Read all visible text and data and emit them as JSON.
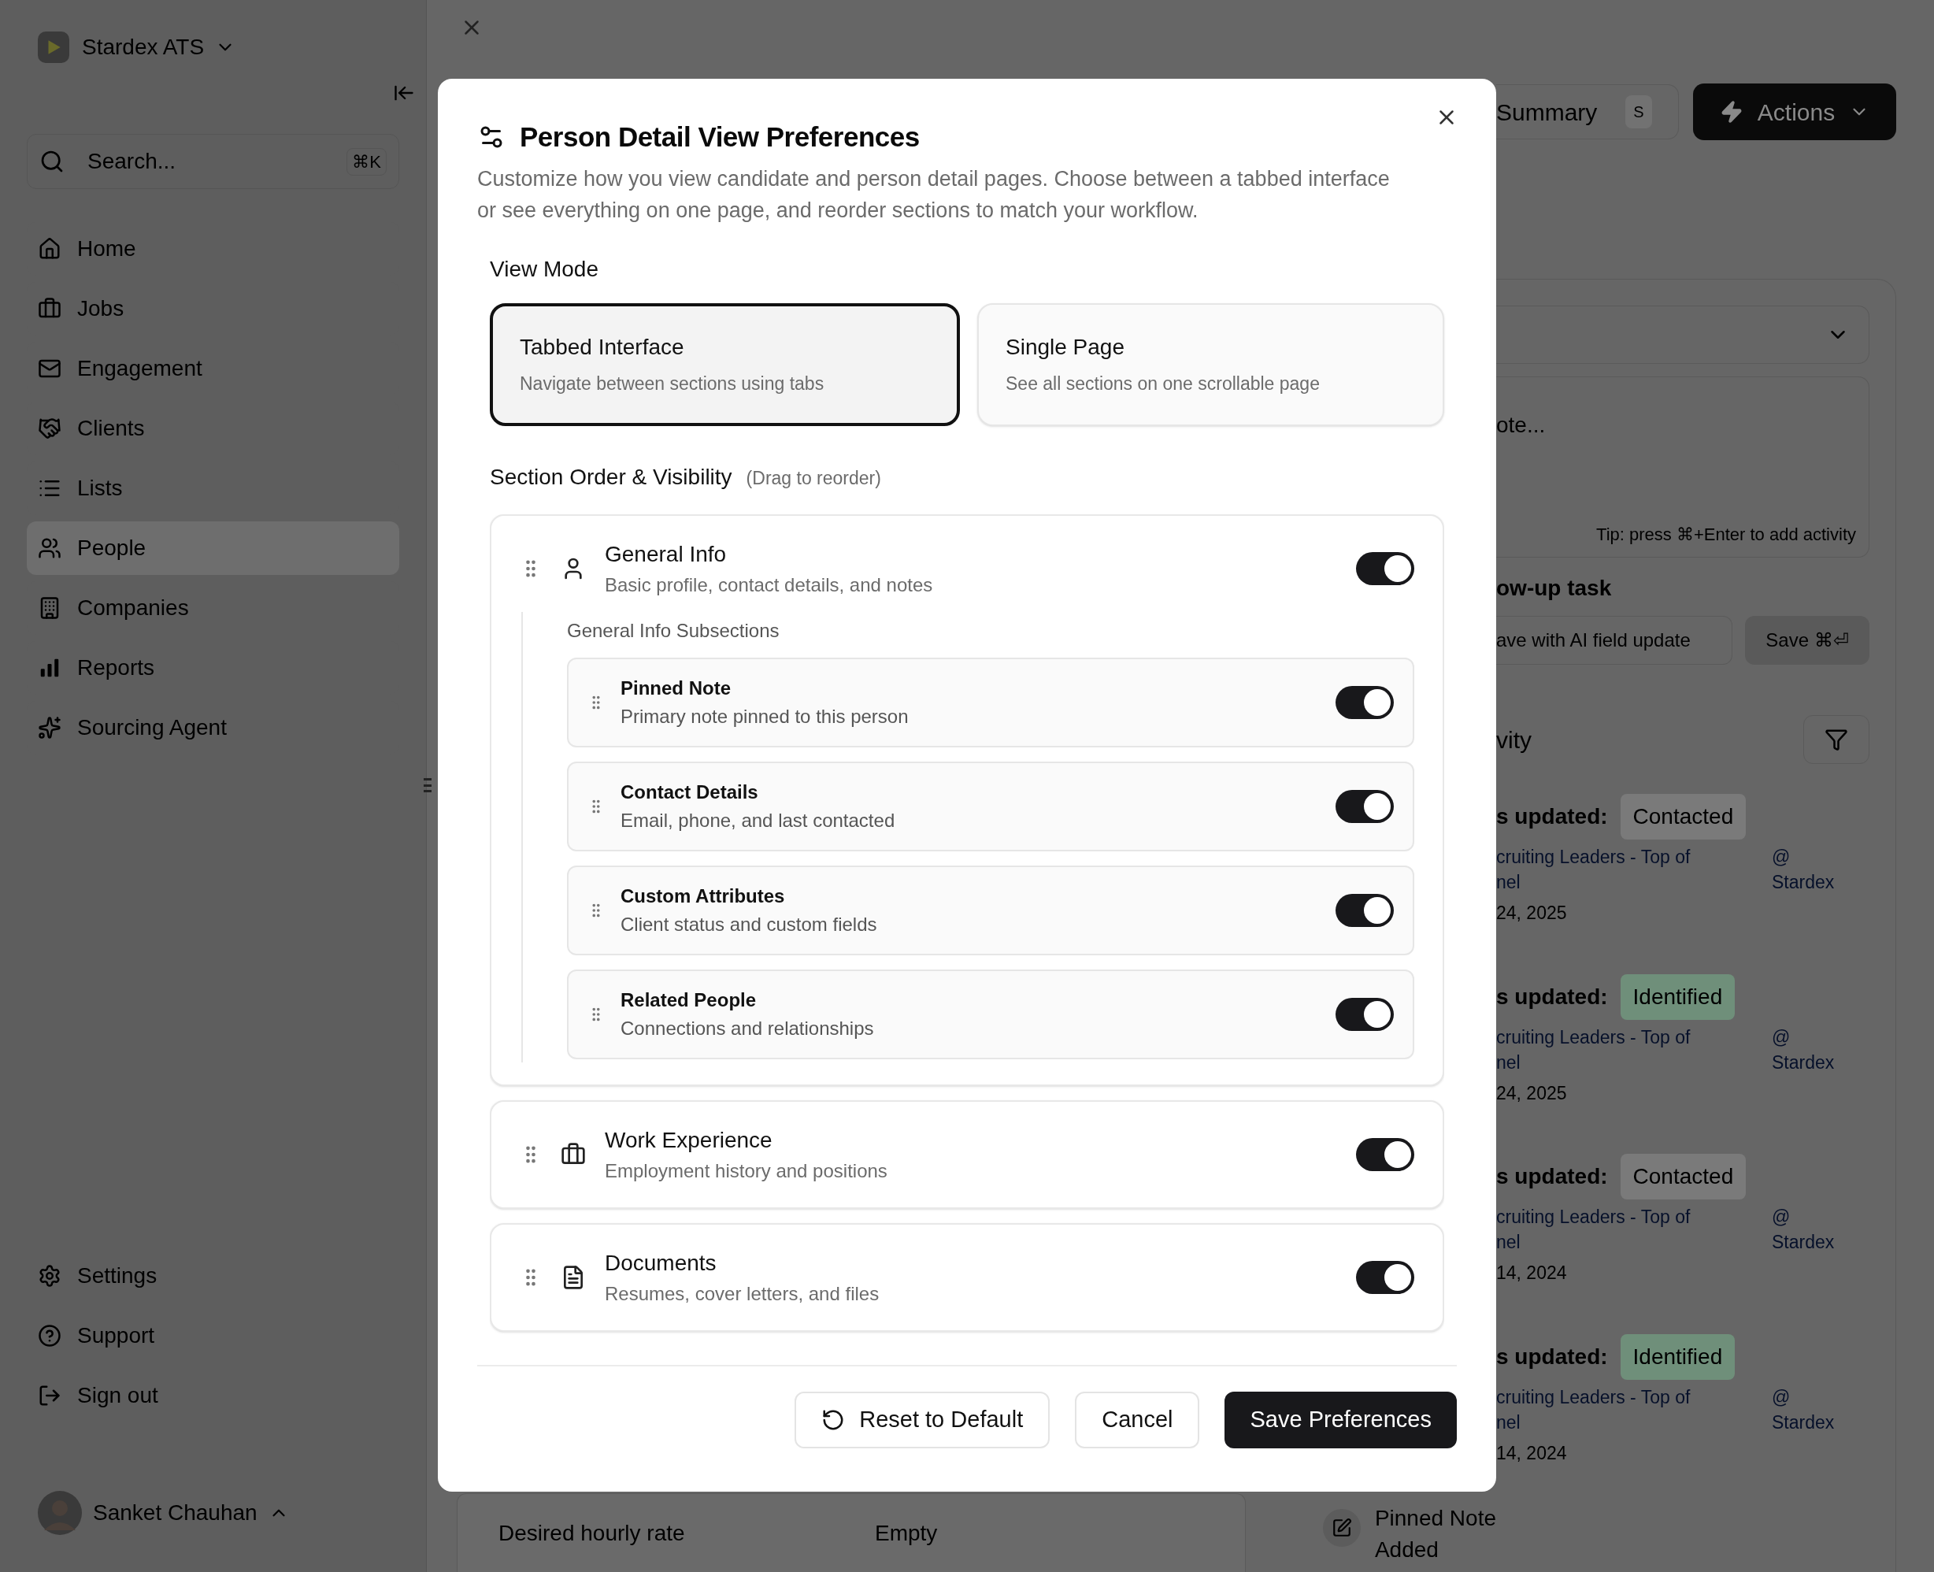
{
  "sidebar": {
    "workspace": "Stardex ATS",
    "search": {
      "placeholder": "Search...",
      "shortcut": "⌘K"
    },
    "nav": [
      {
        "label": "Home",
        "selected": false
      },
      {
        "label": "Jobs",
        "selected": false
      },
      {
        "label": "Engagement",
        "selected": false
      },
      {
        "label": "Clients",
        "selected": false
      },
      {
        "label": "Lists",
        "selected": false
      },
      {
        "label": "People",
        "selected": true
      },
      {
        "label": "Companies",
        "selected": false
      },
      {
        "label": "Reports",
        "selected": false
      },
      {
        "label": "Sourcing Agent",
        "selected": false
      }
    ],
    "footer_nav": [
      {
        "label": "Settings"
      },
      {
        "label": "Support"
      },
      {
        "label": "Sign out"
      }
    ],
    "user": {
      "name": "Sanket Chauhan"
    }
  },
  "page": {
    "summary_button": {
      "label": "Summary",
      "shortcut": "S"
    },
    "actions_button": {
      "label": "Actions"
    },
    "composer": {
      "placeholder": "ote...",
      "tip": "Tip: press ⌘+Enter to add activity",
      "follow_up": "ow-up task",
      "ai_button": "ave with AI field update",
      "save_button": "Save ⌘⏎"
    },
    "activity_heading": "vity",
    "activities": [
      {
        "status_label": "s updated:",
        "status": "Contacted",
        "color": "#7a7a7a",
        "link_lines": [
          "cruiting Leaders - Top of",
          "nel"
        ],
        "by_lines": [
          "@",
          "Stardex"
        ],
        "date": "24, 2025"
      },
      {
        "status_label": "s updated:",
        "status": "Identified",
        "color": "#6f8f7a",
        "link_lines": [
          "cruiting Leaders - Top of",
          "nel"
        ],
        "by_lines": [
          "@",
          "Stardex"
        ],
        "date": "24, 2025"
      },
      {
        "status_label": "s updated:",
        "status": "Contacted",
        "color": "#7a7a7a",
        "link_lines": [
          "cruiting Leaders - Top of",
          "nel"
        ],
        "by_lines": [
          "@",
          "Stardex"
        ],
        "date": "14, 2024"
      },
      {
        "status_label": "s updated:",
        "status": "Identified",
        "color": "#6f8f7a",
        "link_lines": [
          "cruiting Leaders - Top of",
          "nel"
        ],
        "by_lines": [
          "@",
          "Stardex"
        ],
        "date": "14, 2024"
      }
    ],
    "field": {
      "label": "Desired hourly rate",
      "value": "Empty"
    },
    "pinned_note": {
      "title": "Pinned Note",
      "subtitle": "Added"
    }
  },
  "modal": {
    "title": "Person Detail View Preferences",
    "description": "Customize how you view candidate and person detail pages. Choose between a tabbed interface or see everything on one page, and reorder sections to match your workflow.",
    "view_mode": {
      "label": "View Mode",
      "options": [
        {
          "title": "Tabbed Interface",
          "description": "Navigate between sections using tabs",
          "selected": true
        },
        {
          "title": "Single Page",
          "description": "See all sections on one scrollable page",
          "selected": false
        }
      ]
    },
    "sections": {
      "label": "Section Order & Visibility",
      "hint": "(Drag to reorder)",
      "items": [
        {
          "title": "General Info",
          "description": "Basic profile, contact details, and notes",
          "on": true,
          "subsections_label": "General Info Subsections",
          "children": [
            {
              "title": "Pinned Note",
              "description": "Primary note pinned to this person",
              "on": true
            },
            {
              "title": "Contact Details",
              "description": "Email, phone, and last contacted",
              "on": true
            },
            {
              "title": "Custom Attributes",
              "description": "Client status and custom fields",
              "on": true
            },
            {
              "title": "Related People",
              "description": "Connections and relationships",
              "on": true
            }
          ]
        },
        {
          "title": "Work Experience",
          "description": "Employment history and positions",
          "on": true
        },
        {
          "title": "Documents",
          "description": "Resumes, cover letters, and files",
          "on": true
        }
      ]
    },
    "buttons": [
      {
        "label": "Reset to Default",
        "kind": "reset"
      },
      {
        "label": "Cancel",
        "kind": "secondary"
      },
      {
        "label": "Save Preferences",
        "kind": "primary"
      }
    ]
  }
}
